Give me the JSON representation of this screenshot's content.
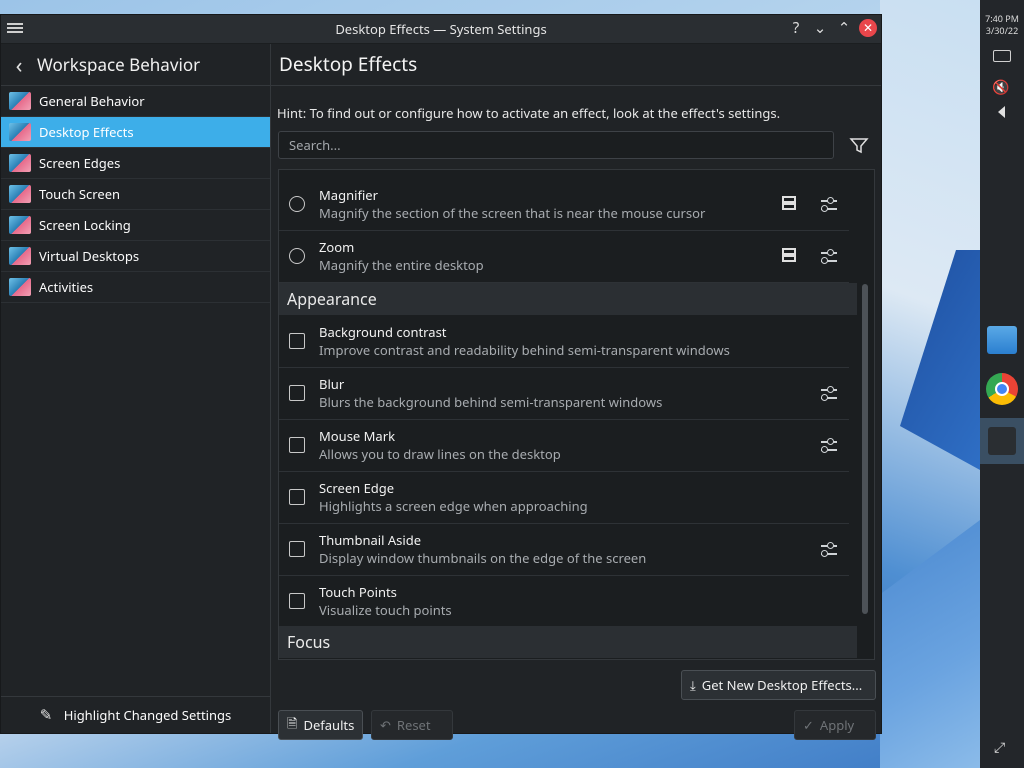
{
  "window": {
    "title": "Desktop Effects — System Settings"
  },
  "sidebar": {
    "header": "Workspace Behavior",
    "items": [
      {
        "label": "General Behavior",
        "active": false
      },
      {
        "label": "Desktop Effects",
        "active": true
      },
      {
        "label": "Screen Edges",
        "active": false
      },
      {
        "label": "Touch Screen",
        "active": false
      },
      {
        "label": "Screen Locking",
        "active": false
      },
      {
        "label": "Virtual Desktops",
        "active": false
      },
      {
        "label": "Activities",
        "active": false
      }
    ],
    "footer": "Highlight Changed Settings"
  },
  "main": {
    "title": "Desktop Effects",
    "hint": "Hint: To find out or configure how to activate an effect, look at the effect's settings.",
    "search_placeholder": "Search...",
    "effects": [
      {
        "name": "Magnifier",
        "desc": "Magnify the section of the screen that is near the mouse cursor"
      },
      {
        "name": "Zoom",
        "desc": "Magnify the entire desktop"
      }
    ],
    "appearance_section": "Appearance",
    "appearance": [
      {
        "name": "Background contrast",
        "desc": "Improve contrast and readability behind semi-transparent windows"
      },
      {
        "name": "Blur",
        "desc": "Blurs the background behind semi-transparent windows"
      },
      {
        "name": "Mouse Mark",
        "desc": "Allows you to draw lines on the desktop"
      },
      {
        "name": "Screen Edge",
        "desc": "Highlights a screen edge when approaching"
      },
      {
        "name": "Thumbnail Aside",
        "desc": "Display window thumbnails on the edge of the screen"
      },
      {
        "name": "Touch Points",
        "desc": "Visualize touch points"
      }
    ],
    "focus_section": "Focus",
    "get_new": "Get New Desktop Effects...",
    "defaults": "Defaults",
    "reset": "Reset",
    "apply": "Apply"
  },
  "panel": {
    "time": "7:40 PM",
    "date": "3/30/22"
  }
}
